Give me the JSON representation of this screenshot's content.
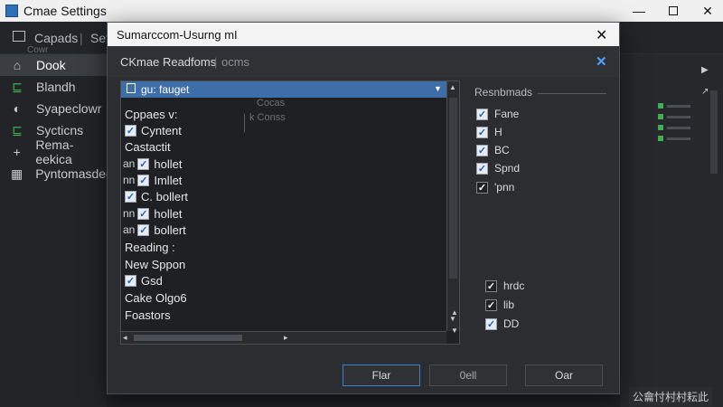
{
  "window": {
    "title": "Cmae Settings",
    "minimize_glyph": "—",
    "close_glyph": "✕"
  },
  "toolbar": {
    "tab1": "Capads",
    "separator": "|",
    "tab2": "Set",
    "subtitle": "Cowr"
  },
  "sidebar": {
    "items": [
      {
        "label": "Dook",
        "icon": "home-icon",
        "glyph": "⌂",
        "active": true
      },
      {
        "label": "Blandh",
        "icon": "branch-icon",
        "glyph": "⊑",
        "active": false
      },
      {
        "label": "Syapeclowr",
        "icon": "sync-icon",
        "glyph": "◐",
        "active": false
      },
      {
        "label": "Sycticns",
        "icon": "checklist-icon",
        "glyph": "⊑",
        "active": false
      },
      {
        "label": "Rema-eekica",
        "icon": "plus-icon",
        "glyph": "+",
        "active": false
      },
      {
        "label": "Pyntomasdeer",
        "icon": "grid-icon",
        "glyph": "▦",
        "active": false
      }
    ]
  },
  "status": {
    "text": "公龠忖村村耘此"
  },
  "dialog": {
    "title": "Sumarccom-Usurng mI",
    "close_glyph": "✕",
    "header": {
      "title": "CKmae Readfoms",
      "separator": "|",
      "subtitle": "ocms",
      "close_glyph": "✕"
    },
    "list": {
      "header": "gu: fauget",
      "ghost_1": "Cocas",
      "ghost_2": "k Conss",
      "rows": [
        {
          "text": "Cppaes v:",
          "prefix": "",
          "checked": false,
          "checkbox": false
        },
        {
          "text": "Cyntent",
          "prefix": "",
          "checked": true,
          "checkbox": true
        },
        {
          "text": "Castactit",
          "prefix": "",
          "checked": false,
          "checkbox": false
        },
        {
          "text": "hollet",
          "prefix": "an",
          "checked": true,
          "checkbox": true
        },
        {
          "text": "Imllet",
          "prefix": "nn",
          "checked": true,
          "checkbox": true
        },
        {
          "text": "C. bollert",
          "prefix": "",
          "checked": true,
          "checkbox": true
        },
        {
          "text": "hollet",
          "prefix": "nn",
          "checked": true,
          "checkbox": true
        },
        {
          "text": "bollert",
          "prefix": "an",
          "checked": true,
          "checkbox": true
        },
        {
          "text": "Reading :",
          "prefix": "",
          "checked": false,
          "checkbox": false
        },
        {
          "text": "New Sppon",
          "prefix": "",
          "checked": false,
          "checkbox": false
        },
        {
          "text": "Gsd",
          "prefix": "",
          "checked": true,
          "checkbox": true
        },
        {
          "text": "Cake Olgo6",
          "prefix": "",
          "checked": false,
          "checkbox": false
        },
        {
          "text": "Foastors",
          "prefix": "",
          "checked": false,
          "checkbox": false
        }
      ]
    },
    "results": {
      "label": "Resnbmads",
      "options": [
        {
          "label": "Fane",
          "checked": true
        },
        {
          "label": "H",
          "checked": true
        },
        {
          "label": "BC",
          "checked": true
        },
        {
          "label": "Spnd",
          "checked": true
        },
        {
          "label": "'pnn",
          "checked": true
        }
      ],
      "options2": [
        {
          "label": "hrdc",
          "checked": true
        },
        {
          "label": "lib",
          "checked": true
        },
        {
          "label": "DD",
          "checked": true
        }
      ]
    },
    "buttons": {
      "ok": "Flar",
      "cancel": "0ell",
      "apply": "Oar"
    }
  }
}
